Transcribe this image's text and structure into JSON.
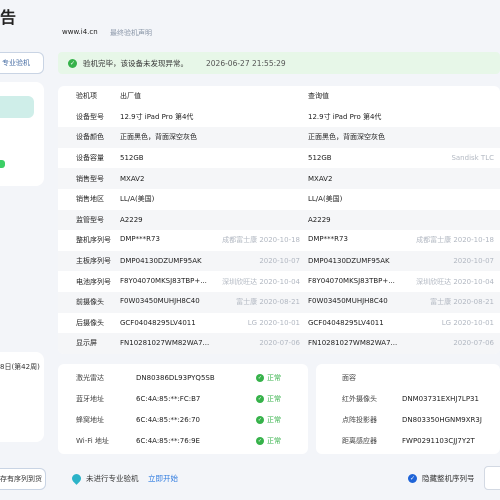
{
  "sidebar": {
    "title_fragment": "告",
    "pro_button": "专业验机",
    "date_fragment": "8日(第42周)",
    "bottom_button": "存有序列到货"
  },
  "header": {
    "site": "www.i4.cn",
    "statement_link": "最终验机声明"
  },
  "banner": {
    "message": "验机完毕，该设备未发现异常。",
    "timestamp": "2026-06-27 21:55:29"
  },
  "table": {
    "headers": {
      "label": "验机项",
      "factory": "出厂值",
      "query": "查询值"
    },
    "rows": [
      {
        "label": "设备型号",
        "factory": "12.9寸 iPad Pro 第4代",
        "factory_note": "",
        "query": "12.9寸 iPad Pro 第4代",
        "query_note": ""
      },
      {
        "label": "设备颜色",
        "factory": "正面黑色，背面深空灰色",
        "factory_note": "",
        "query": "正面黑色，背面深空灰色",
        "query_note": ""
      },
      {
        "label": "设备容量",
        "factory": "512GB",
        "factory_note": "",
        "query": "512GB",
        "query_note": "Sandisk TLC"
      },
      {
        "label": "销售型号",
        "factory": "MXAV2",
        "factory_note": "",
        "query": "MXAV2",
        "query_note": ""
      },
      {
        "label": "销售地区",
        "factory": "LL/A(美国)",
        "factory_note": "",
        "query": "LL/A(美国)",
        "query_note": ""
      },
      {
        "label": "监管型号",
        "factory": "A2229",
        "factory_note": "",
        "query": "A2229",
        "query_note": ""
      },
      {
        "label": "整机序列号",
        "factory": "DMP***R73",
        "factory_note": "成都富士康 2020-10-18",
        "query": "DMP***R73",
        "query_note": "成都富士康 2020-10-18"
      },
      {
        "label": "主板序列号",
        "factory": "DMP04130DZUMF95AK",
        "factory_note": "2020-10-07",
        "query": "DMP04130DZUMF95AK",
        "query_note": "2020-10-07"
      },
      {
        "label": "电池序列号",
        "factory": "F8Y04070MKSJ83TBP+...",
        "factory_note": "深圳欣旺达 2020-10-04",
        "query": "F8Y04070MKSJ83TBP+...",
        "query_note": "深圳欣旺达 2020-10-04"
      },
      {
        "label": "前摄像头",
        "factory": "F0W03450MUHJH8C40",
        "factory_note": "富士康 2020-08-21",
        "query": "F0W03450MUHJH8C40",
        "query_note": "富士康 2020-08-21"
      },
      {
        "label": "后摄像头",
        "factory": "GCF04048295LV4011",
        "factory_note": "LG 2020-10-01",
        "query": "GCF04048295LV4011",
        "query_note": "LG 2020-10-01"
      },
      {
        "label": "显示屏",
        "factory": "FN10281027WM82WA7...",
        "factory_note": "2020-07-06",
        "query": "FN10281027WM82WA7...",
        "query_note": "2020-07-06"
      }
    ]
  },
  "bottom_left": [
    {
      "label": "激光雷达",
      "value": "DN80386DL93PYQ5SB",
      "status": "正常"
    },
    {
      "label": "蓝牙地址",
      "value": "6C:4A:85:**:FC:B7",
      "status": "正常"
    },
    {
      "label": "蜂窝地址",
      "value": "6C:4A:85:**:26:70",
      "status": "正常"
    },
    {
      "label": "Wi-Fi 地址",
      "value": "6C:4A:85:**:76:9E",
      "status": "正常"
    }
  ],
  "bottom_right": [
    {
      "label": "面容",
      "value": ""
    },
    {
      "label": "红外摄像头",
      "value": "DNM03731EXHJ7LP31"
    },
    {
      "label": "点阵投影器",
      "value": "DN803350HGNM9XR3J"
    },
    {
      "label": "距离感应器",
      "value": "FWP0291103CJJ7Y2T"
    }
  ],
  "footer": {
    "pro_text": "未进行专业验机",
    "start_link": "立即开始",
    "hide_serial_label": "隐藏整机序列号"
  }
}
